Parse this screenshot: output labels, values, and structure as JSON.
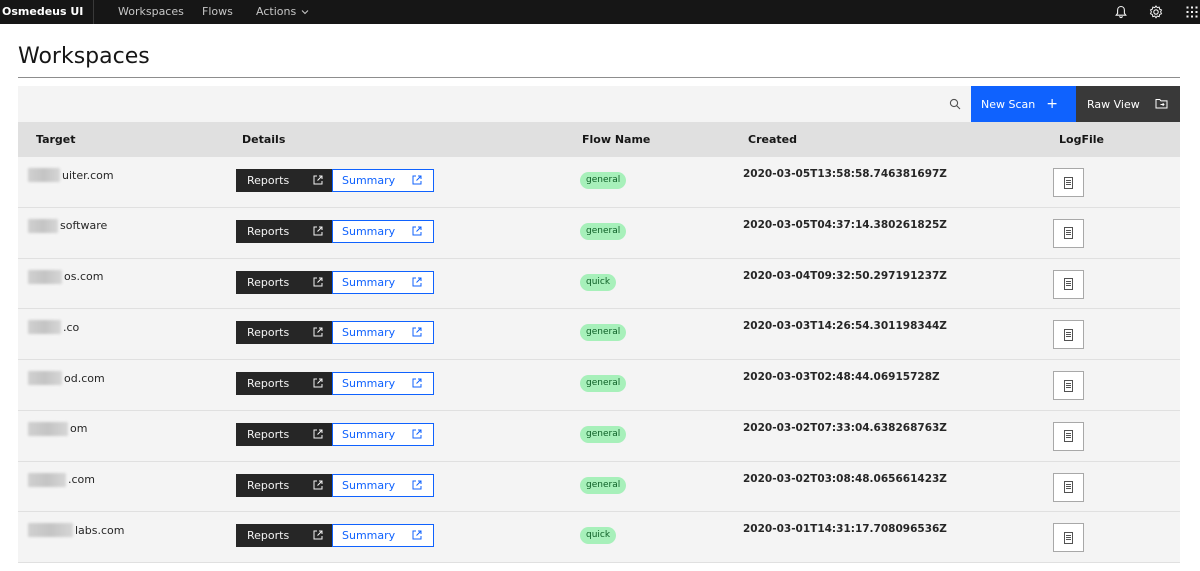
{
  "header": {
    "brand": "Osmedeus UI",
    "nav": {
      "workspaces": "Workspaces",
      "flows": "Flows",
      "actions": "Actions"
    },
    "icons": [
      "notification-icon",
      "settings-icon",
      "app-switcher-icon"
    ]
  },
  "page": {
    "title": "Workspaces"
  },
  "toolbar": {
    "search_icon": "search-icon",
    "new_scan": "New Scan",
    "new_scan_icon": "+",
    "raw_view": "Raw View",
    "raw_view_icon": "folder-icon"
  },
  "table": {
    "headers": {
      "target": "Target",
      "details": "Details",
      "flow_name": "Flow Name",
      "created": "Created",
      "logfile": "LogFile"
    },
    "rows": [
      {
        "target": "uiter.com",
        "reports": "Reports",
        "summary": "Summary",
        "flow": "general",
        "created": "2020-03-05T13:58:58.746381697Z"
      },
      {
        "target": "software",
        "reports": "Reports",
        "summary": "Summary",
        "flow": "general",
        "created": "2020-03-05T04:37:14.380261825Z"
      },
      {
        "target": "os.com",
        "reports": "Reports",
        "summary": "Summary",
        "flow": "quick",
        "created": "2020-03-04T09:32:50.297191237Z"
      },
      {
        "target": ".co",
        "reports": "Reports",
        "summary": "Summary",
        "flow": "general",
        "created": "2020-03-03T14:26:54.301198344Z"
      },
      {
        "target": "od.com",
        "reports": "Reports",
        "summary": "Summary",
        "flow": "general",
        "created": "2020-03-03T02:48:44.06915728Z"
      },
      {
        "target": "om",
        "reports": "Reports",
        "summary": "Summary",
        "flow": "general",
        "created": "2020-03-02T07:33:04.638268763Z"
      },
      {
        "target": ".com",
        "reports": "Reports",
        "summary": "Summary",
        "flow": "general",
        "created": "2020-03-02T03:08:48.065661423Z"
      },
      {
        "target": "labs.com",
        "reports": "Reports",
        "summary": "Summary",
        "flow": "quick",
        "created": "2020-03-01T14:31:17.708096536Z"
      }
    ]
  },
  "colors": {
    "primary": "#0f62fe",
    "header_bg": "#161616",
    "tag_bg": "#a7f0ba",
    "tag_text": "#0e6027"
  }
}
